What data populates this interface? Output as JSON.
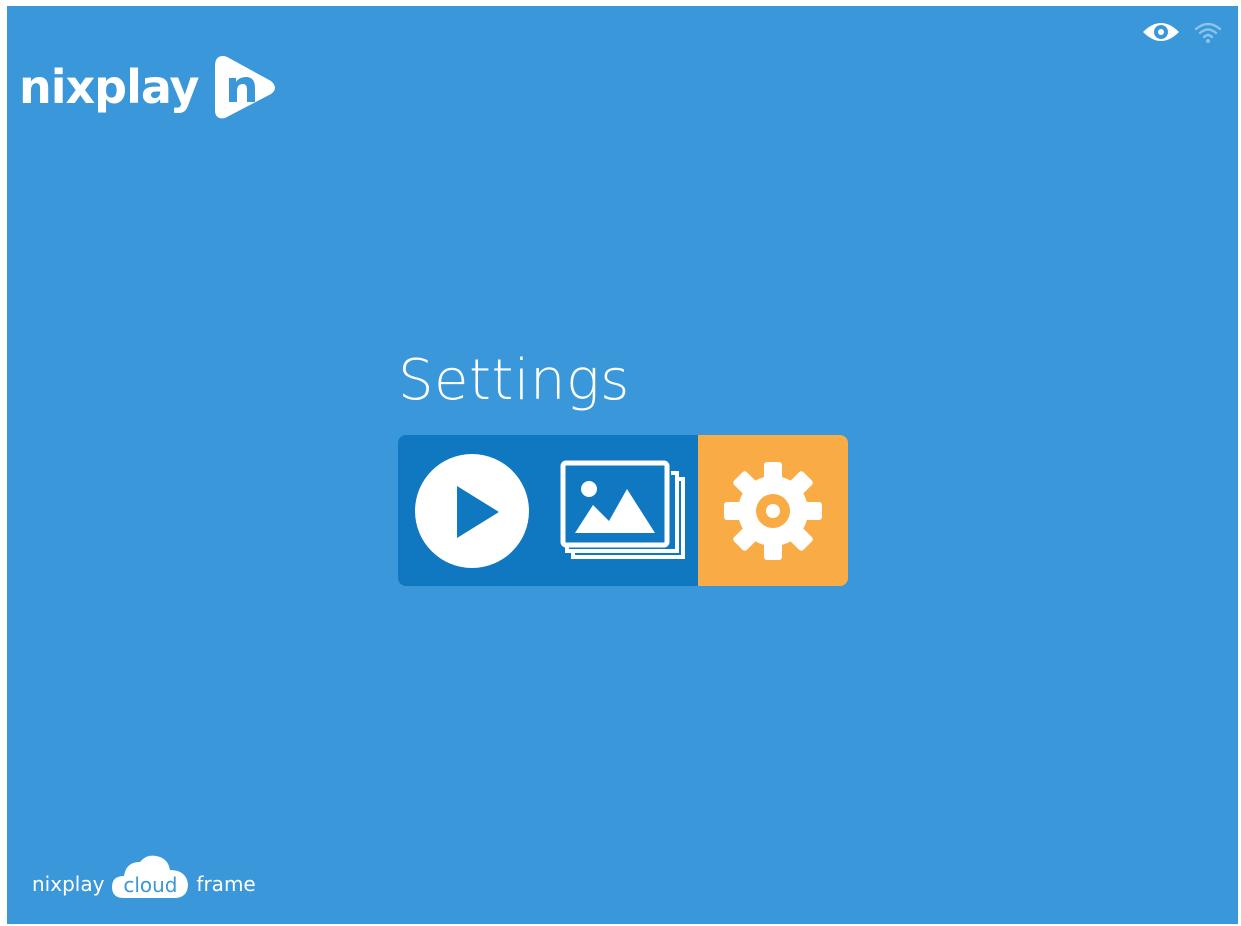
{
  "header": {
    "logo_text": "nixplay",
    "logo_mark_icon": "nixplay-n-icon",
    "status_icons": [
      "eye-icon",
      "wifi-icon"
    ]
  },
  "menu": {
    "title": "Settings",
    "buttons": [
      {
        "name": "play-button",
        "icon": "play-icon",
        "selected": false
      },
      {
        "name": "photos-button",
        "icon": "photos-icon",
        "selected": false
      },
      {
        "name": "settings-button",
        "icon": "gear-icon",
        "selected": true
      }
    ]
  },
  "footer": {
    "brand_prefix": "nixplay",
    "brand_cloud": "cloud",
    "brand_suffix": "frame"
  },
  "colors": {
    "background": "#3a97d9",
    "menu_bar": "#0f78c1",
    "selected_accent": "#f9ac45",
    "foreground": "#ffffff"
  }
}
